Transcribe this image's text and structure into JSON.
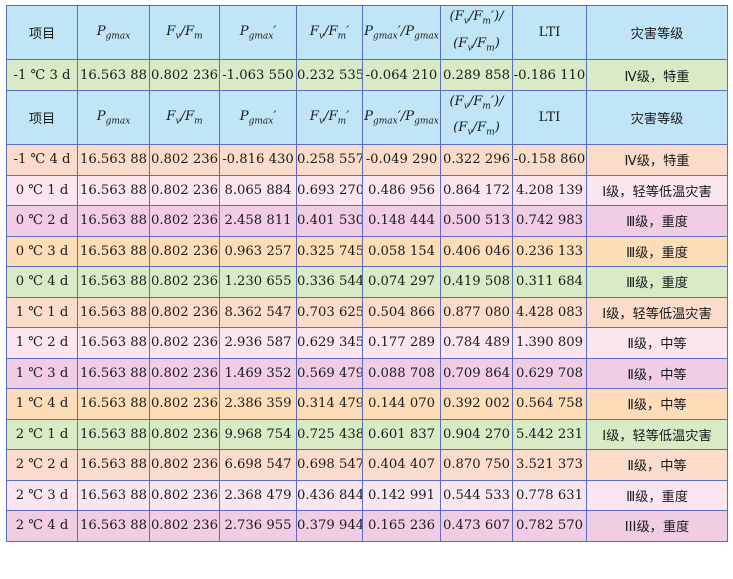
{
  "header": {
    "item": "项目",
    "pg": "P",
    "pg_sub": "gmax",
    "fvfm_a": "F",
    "fvfm_a_sub": "v",
    "fvfm_b": "F",
    "fvfm_b_sub": "m",
    "pg2": "P",
    "pg2_sub": "gmax",
    "pg2_mark": "′",
    "fvfm2_a": "F",
    "fvfm2_a_sub": "v",
    "fvfm2_b": "F",
    "fvfm2_b_sub": "m",
    "fvfm2_mark": "′",
    "ratio_a": "P",
    "ratio_a_sub": "gmax",
    "ratio_mark": "′",
    "ratio_b": "P",
    "ratio_b_sub": "gmax",
    "frac_top": "(F",
    "frac_top_sub1": "v",
    "frac_top_mid": "/F",
    "frac_top_sub2": "m",
    "frac_top_end": "′)/",
    "frac_bot": "(F",
    "frac_bot_sub1": "v",
    "frac_bot_mid": "/F",
    "frac_bot_sub2": "m",
    "frac_bot_end": ")",
    "lti": "LTI",
    "grade": "灾害等级"
  },
  "rows_top": [
    {
      "item": "-1 ℃ 3 d",
      "pg": "16.563 88",
      "fvfm": "0.802 236",
      "pg2": "-1.063 550",
      "fvfm2": "0.232 535",
      "ratio": "-0.064 210",
      "frac": "0.289 858",
      "lti": "-0.186 110",
      "grade": "Ⅳ级，特重",
      "color": "green"
    }
  ],
  "rows": [
    {
      "item": "-1 ℃ 4 d",
      "pg": "16.563 88",
      "fvfm": "0.802 236",
      "pg2": "-0.816 430",
      "fvfm2": "0.258 557",
      "ratio": "-0.049 290",
      "frac": "0.322 296",
      "lti": "-0.158 860",
      "grade": "Ⅳ级，特重",
      "color": "peach"
    },
    {
      "item": "0 ℃ 1 d",
      "pg": "16.563 88",
      "fvfm": "0.802 236",
      "pg2": "8.065 884",
      "fvfm2": "0.693 270",
      "ratio": "0.486 956",
      "frac": "0.864 172",
      "lti": "4.208 139",
      "grade": "Ⅰ级，轻等低温灾害",
      "color": "pink"
    },
    {
      "item": "0 ℃ 2 d",
      "pg": "16.563 88",
      "fvfm": "0.802 236",
      "pg2": "2.458 811",
      "fvfm2": "0.401 530",
      "ratio": "0.148 444",
      "frac": "0.500 513",
      "lti": "0.742 983",
      "grade": "Ⅲ级，重度",
      "color": "magenta"
    },
    {
      "item": "0 ℃ 3 d",
      "pg": "16.563 88",
      "fvfm": "0.802 236",
      "pg2": "0.963 257",
      "fvfm2": "0.325 745",
      "ratio": "0.058 154",
      "frac": "0.406 046",
      "lti": "0.236 133",
      "grade": "Ⅲ级，重度",
      "color": "orange"
    },
    {
      "item": "0 ℃ 4 d",
      "pg": "16.563 88",
      "fvfm": "0.802 236",
      "pg2": "1.230 655",
      "fvfm2": "0.336 544",
      "ratio": "0.074 297",
      "frac": "0.419 508",
      "lti": "0.311 684",
      "grade": "Ⅲ级，重度",
      "color": "green"
    },
    {
      "item": "1 ℃ 1 d",
      "pg": "16.563 88",
      "fvfm": "0.802 236",
      "pg2": "8.362 547",
      "fvfm2": "0.703 625",
      "ratio": "0.504 866",
      "frac": "0.877 080",
      "lti": "4.428 083",
      "grade": "Ⅰ级，轻等低温灾害",
      "color": "peach"
    },
    {
      "item": "1 ℃ 2 d",
      "pg": "16.563 88",
      "fvfm": "0.802 236",
      "pg2": "2.936 587",
      "fvfm2": "0.629 345",
      "ratio": "0.177 289",
      "frac": "0.784 489",
      "lti": "1.390 809",
      "grade": "Ⅱ级，中等",
      "color": "pink"
    },
    {
      "item": "1 ℃ 3 d",
      "pg": "16.563 88",
      "fvfm": "0.802 236",
      "pg2": "1.469 352",
      "fvfm2": "0.569 479",
      "ratio": "0.088 708",
      "frac": "0.709 864",
      "lti": "0.629 708",
      "grade": "Ⅱ级，中等",
      "color": "magenta"
    },
    {
      "item": "1 ℃ 4 d",
      "pg": "16.563 88",
      "fvfm": "0.802 236",
      "pg2": "2.386 359",
      "fvfm2": "0.314 479",
      "ratio": "0.144 070",
      "frac": "0.392 002",
      "lti": "0.564 758",
      "grade": "Ⅱ级，中等",
      "color": "orange"
    },
    {
      "item": "2 ℃ 1 d",
      "pg": "16.563 88",
      "fvfm": "0.802 236",
      "pg2": "9.968 754",
      "fvfm2": "0.725 438",
      "ratio": "0.601 837",
      "frac": "0.904 270",
      "lti": "5.442 231",
      "grade": "Ⅰ级，轻等低温灾害",
      "color": "green"
    },
    {
      "item": "2 ℃ 2 d",
      "pg": "16.563 88",
      "fvfm": "0.802 236",
      "pg2": "6.698 547",
      "fvfm2": "0.698 547",
      "ratio": "0.404 407",
      "frac": "0.870 750",
      "lti": "3.521 373",
      "grade": "Ⅱ级，中等",
      "color": "peach"
    },
    {
      "item": "2 ℃ 3 d",
      "pg": "16.563 88",
      "fvfm": "0.802 236",
      "pg2": "2.368 479",
      "fvfm2": "0.436 844",
      "ratio": "0.142 991",
      "frac": "0.544 533",
      "lti": "0.778 631",
      "grade": "Ⅲ级，重度",
      "color": "pink"
    },
    {
      "item": "2 ℃ 4 d",
      "pg": "16.563 88",
      "fvfm": "0.802 236",
      "pg2": "2.736 955",
      "fvfm2": "0.379 944",
      "ratio": "0.165 236",
      "frac": "0.473 607",
      "lti": "0.782 570",
      "grade": "III级，重度",
      "color": "magenta"
    }
  ]
}
